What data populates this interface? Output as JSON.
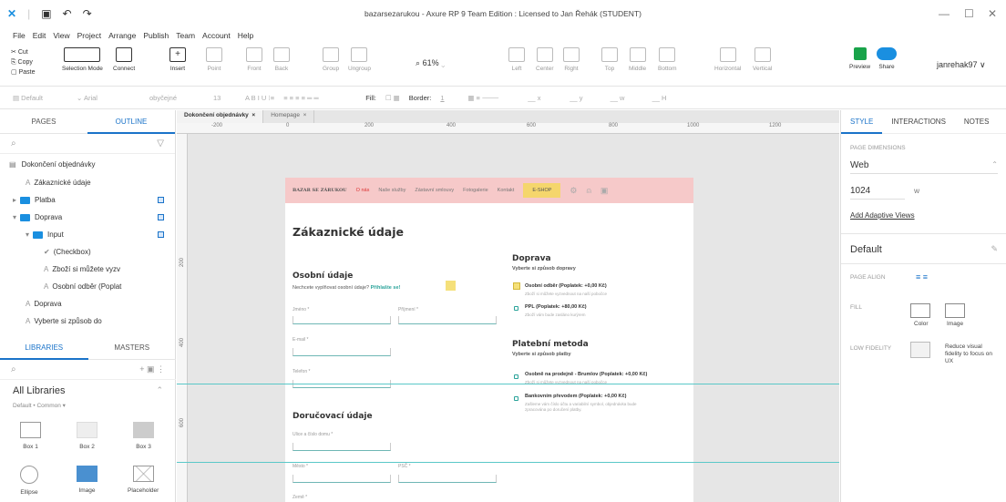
{
  "window": {
    "title": "bazarsezarukou - Axure RP 9 Team Edition : Licensed to Jan Řehák (STUDENT)",
    "controls": [
      "—",
      "☐",
      "✕"
    ]
  },
  "menu": [
    "File",
    "Edit",
    "View",
    "Project",
    "Arrange",
    "Publish",
    "Team",
    "Account",
    "Help"
  ],
  "clipboard": [
    "Cut",
    "Copy",
    "Paste"
  ],
  "toolbar": {
    "selection_mode": "Selection Mode",
    "connect": "Connect",
    "insert": "Insert",
    "point": "Point",
    "front": "Front",
    "back": "Back",
    "group": "Group",
    "ungroup": "Ungroup",
    "zoom": "61%",
    "left": "Left",
    "center": "Center",
    "right": "Right",
    "top": "Top",
    "middle": "Middle",
    "bottom": "Bottom",
    "horizontal": "Horizontal",
    "vertical": "Vertical",
    "preview": "Preview",
    "share": "Share",
    "user": "janrehak97"
  },
  "format": {
    "style": "Default",
    "font": "Arial",
    "weight": "obyčejné",
    "size": "13",
    "fill_label": "Fill:",
    "border_label": "Border:",
    "border_value": "1",
    "x_label": "x",
    "y_label": "y",
    "w_label": "w",
    "h_label": "H"
  },
  "left_panel": {
    "tab_pages": "PAGES",
    "tab_outline": "OUTLINE",
    "page_name": "Dokončení objednávky",
    "tree": [
      {
        "label": "Zákaznické údaje",
        "type": "text",
        "indent": 1
      },
      {
        "label": "Platba",
        "type": "folder",
        "indent": 0
      },
      {
        "label": "Doprava",
        "type": "folder",
        "indent": 0
      },
      {
        "label": "Input",
        "type": "folder",
        "indent": 1
      },
      {
        "label": "(Checkbox)",
        "type": "check",
        "indent": 2
      },
      {
        "label": "Zboží si můžete vyzv",
        "type": "text",
        "indent": 3
      },
      {
        "label": "Osobní odběr (Poplat",
        "type": "text",
        "indent": 3
      },
      {
        "label": "Doprava",
        "type": "text",
        "indent": 1
      },
      {
        "label": "Vyberte si způsob do",
        "type": "text",
        "indent": 1
      }
    ],
    "tab_libraries": "LIBRARIES",
    "tab_masters": "MASTERS",
    "library_name": "All Libraries",
    "library_sub": "Default • Common ▾",
    "widgets": [
      "Box 1",
      "Box 2",
      "Box 3",
      "Ellipse",
      "Image",
      "Placeholder"
    ]
  },
  "doc_tabs": [
    "Dokončení objednávky",
    "Homepage"
  ],
  "ruler_h": [
    "-200",
    "0",
    "200",
    "400",
    "600",
    "800",
    "1000",
    "1200"
  ],
  "ruler_v": [
    "200",
    "400",
    "600"
  ],
  "page": {
    "logo": "BAZAR SE ZÁRUKOU",
    "nav": [
      "O nás",
      "Naše služby",
      "Zástavní smlouvy",
      "Fotogalerie",
      "Kontakt"
    ],
    "eshop": "E-SHOP",
    "heading": "Zákaznické údaje",
    "personal_heading": "Osobní údaje",
    "personal_sub": "Nechcete vyplňovat osobní údaje?",
    "login_link": "Přihlašte se!",
    "fields": {
      "first_name": "Jméno *",
      "last_name": "Příjmení *",
      "email": "E-mail *",
      "phone": "Telefon *",
      "street": "Ulice a číslo domu *",
      "city": "Město *",
      "zip": "PSČ *",
      "country": "Země *"
    },
    "delivery_heading": "Doručovací údaje",
    "shipping_heading": "Doprava",
    "shipping_sub": "Vyberte si způsob dopravy",
    "shipping_options": [
      {
        "label": "Osobní odběr (Poplatek: +0,00 Kč)",
        "sub": "Zboží si můžete vyzvednout na naší pobočce"
      },
      {
        "label": "PPL (Poplatek: +80,00 Kč)",
        "sub": "Zboží vám bude zasláno kurýrem"
      }
    ],
    "payment_heading": "Platební metoda",
    "payment_sub": "Vyberte si způsob platby",
    "payment_options": [
      {
        "label": "Osobně na prodejně - Brumlov (Poplatek: +0,00 Kč)",
        "sub": "Zboží si můžete vyzvednout na naší pobočce"
      },
      {
        "label": "Bankovním převodem (Poplatek: +0,00 Kč)",
        "sub": "Zašleme vám číslo účtu a variabilní symbol, objednávka bude zpracována po doručení platby."
      }
    ]
  },
  "right_panel": {
    "tabs": [
      "STYLE",
      "INTERACTIONS",
      "NOTES"
    ],
    "page_dimensions_label": "PAGE DIMENSIONS",
    "page_dimensions_value": "Web",
    "width_value": "1024",
    "width_unit": "W",
    "adaptive_link": "Add Adaptive Views",
    "style_name": "Default",
    "page_align_label": "PAGE ALIGN",
    "fill_label": "FILL",
    "fill_color": "Color",
    "fill_image": "Image",
    "low_fidelity_label": "LOW FIDELITY",
    "low_fidelity_text": "Reduce visual fidelity to focus on UX"
  },
  "colors": {
    "accent": "#1a73c9",
    "header_pink": "#f6c9c9",
    "eshop_yellow": "#f5d66c",
    "guide_teal": "#5ac8c8"
  }
}
